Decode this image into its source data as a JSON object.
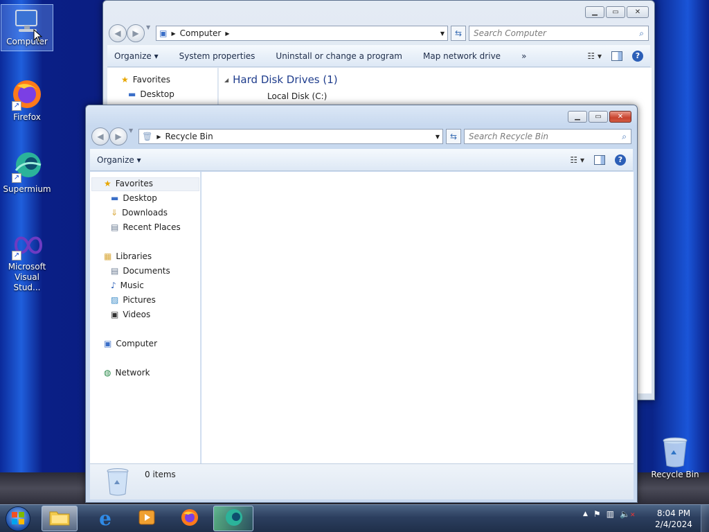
{
  "desktop": {
    "icons": [
      {
        "label": "Computer"
      },
      {
        "label": "Firefox"
      },
      {
        "label": "Supermium"
      },
      {
        "label": "Microsoft Visual Stud..."
      },
      {
        "label": "Recycle Bin"
      }
    ]
  },
  "back_window": {
    "address_path": "Computer",
    "search_placeholder": "Search Computer",
    "toolbar": [
      "Organize",
      "System properties",
      "Uninstall or change a program",
      "Map network drive",
      "»"
    ],
    "nav": [
      "Favorites",
      "Desktop"
    ],
    "group_header": "Hard Disk Drives (1)",
    "drive": "Local Disk (C:)"
  },
  "front_window": {
    "address_path": "Recycle Bin",
    "search_placeholder": "Search Recycle Bin",
    "toolbar": {
      "organize": "Organize"
    },
    "nav": {
      "favorites": "Favorites",
      "desktop": "Desktop",
      "downloads": "Downloads",
      "recent": "Recent Places",
      "libraries": "Libraries",
      "documents": "Documents",
      "music": "Music",
      "pictures": "Pictures",
      "videos": "Videos",
      "computer": "Computer",
      "network": "Network"
    },
    "status": "0 items"
  },
  "taskbar": {
    "time": "8:04 PM",
    "date": "2/4/2024",
    "apps": [
      "explorer",
      "internet-explorer",
      "media-player",
      "firefox",
      "supermium"
    ]
  },
  "colors": {
    "taskbar": "#2c3f5f",
    "accent": "#2c5fb7",
    "close": "#c8432e"
  }
}
